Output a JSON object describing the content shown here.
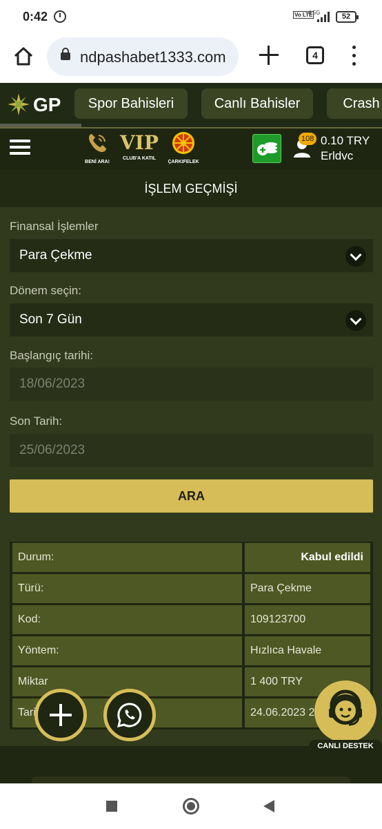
{
  "status_bar": {
    "time": "0:42",
    "network": "4.5G",
    "volte": "Vo LTE",
    "battery": "52"
  },
  "browser": {
    "url": "ndpashabet1333.com",
    "tab_count": "4"
  },
  "site_nav": {
    "logo_text": "GP",
    "tabs": [
      {
        "label": "Spor Bahisleri"
      },
      {
        "label": "Canlı Bahisler"
      },
      {
        "label": "Crash"
      }
    ]
  },
  "header2": {
    "promo_call": "BENİ ARA!",
    "promo_vip_logo": "VIP",
    "promo_vip": "CLUB'A KATIL",
    "promo_wheel": "ÇARKIFELEK",
    "badge_count": "108",
    "balance": "0.10 TRY",
    "username": "Erldvc"
  },
  "page": {
    "title": "İŞLEM GEÇMİŞİ"
  },
  "form": {
    "financial_label": "Finansal İşlemler",
    "financial_value": "Para Çekme",
    "period_label": "Dönem seçin:",
    "period_value": "Son 7 Gün",
    "start_label": "Başlangıç tarihi:",
    "start_value": "18/06/2023",
    "end_label": "Son Tarih:",
    "end_value": "25/06/2023",
    "search_button": "ARA"
  },
  "results": {
    "rows": [
      {
        "key": "Durum:",
        "value": "Kabul edildi"
      },
      {
        "key": "Türü:",
        "value": "Para Çekme"
      },
      {
        "key": "Kod:",
        "value": "109123700"
      },
      {
        "key": "Yöntem:",
        "value": "Hızlıca Havale"
      },
      {
        "key": "Miktar",
        "value": "1 400 TRY"
      },
      {
        "key": "Tari",
        "value": "24.06.2023 2"
      }
    ]
  },
  "support": {
    "label": "CANLI DESTEK"
  },
  "colors": {
    "accent": "#d6bd58",
    "background": "#313a1c",
    "cell": "#4e5824"
  }
}
